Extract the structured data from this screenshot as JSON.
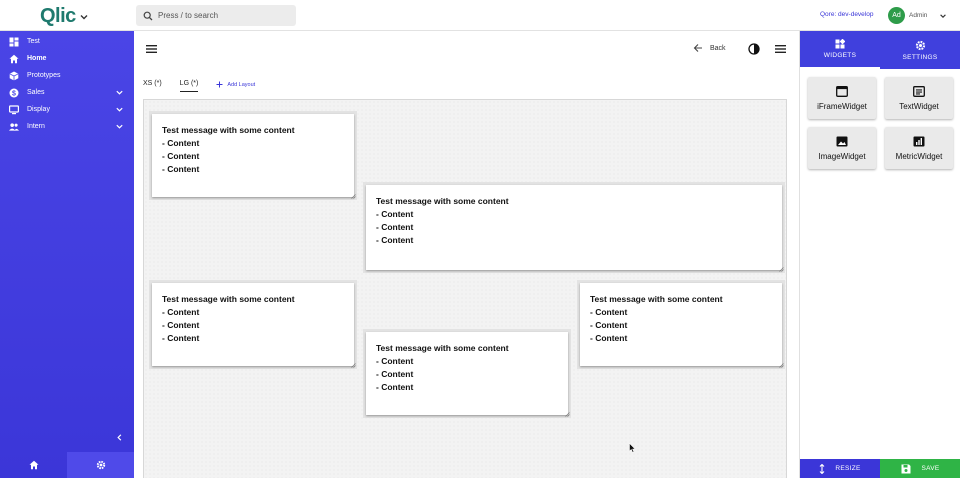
{
  "header": {
    "logo_text": "Qlic",
    "search_placeholder": "Press / to search",
    "qore_label": "Qore: dev-develop",
    "avatar_initials": "Ad",
    "user_name": "Admin"
  },
  "sidebar": {
    "items": [
      {
        "label": "Test",
        "icon": "dashboard-icon"
      },
      {
        "label": "Home",
        "icon": "home-icon",
        "active": true
      },
      {
        "label": "Prototypes",
        "icon": "box-icon"
      },
      {
        "label": "Sales",
        "icon": "dollar-icon",
        "expandable": true
      },
      {
        "label": "Display",
        "icon": "monitor-icon",
        "expandable": true
      },
      {
        "label": "Intern",
        "icon": "people-icon",
        "expandable": true
      }
    ]
  },
  "main": {
    "back_label": "Back",
    "tabs": [
      {
        "label": "XS (*)"
      },
      {
        "label": "LG (*)",
        "active": true
      }
    ],
    "add_layout_label": "Add Layout",
    "widgets": [
      {
        "title": "Test message with some content",
        "lines": [
          "- Content",
          "- Content",
          "- Content"
        ]
      },
      {
        "title": "Test message with some content",
        "lines": [
          "- Content",
          "- Content",
          "- Content"
        ]
      },
      {
        "title": "Test message with some content",
        "lines": [
          "- Content",
          "- Content",
          "- Content"
        ]
      },
      {
        "title": "Test message with some content",
        "lines": [
          "- Content",
          "- Content",
          "- Content"
        ]
      },
      {
        "title": "Test message with some content",
        "lines": [
          "- Content",
          "- Content",
          "- Content"
        ]
      }
    ]
  },
  "right_panel": {
    "tabs": [
      {
        "label": "WIDGETS",
        "icon": "widgets-icon",
        "active": true
      },
      {
        "label": "SETTINGS",
        "icon": "gear-icon"
      }
    ],
    "widget_types": [
      {
        "label": "iFrameWidget",
        "icon": "iframe-icon"
      },
      {
        "label": "TextWidget",
        "icon": "text-icon"
      },
      {
        "label": "ImageWidget",
        "icon": "image-icon"
      },
      {
        "label": "MetricWidget",
        "icon": "metric-icon"
      }
    ],
    "resize_label": "RESIZE",
    "save_label": "SAVE"
  },
  "colors": {
    "sidebar": "#3b36d8",
    "accent": "#3a36d8",
    "save": "#2fb446",
    "logo": "#1f7a6e"
  }
}
